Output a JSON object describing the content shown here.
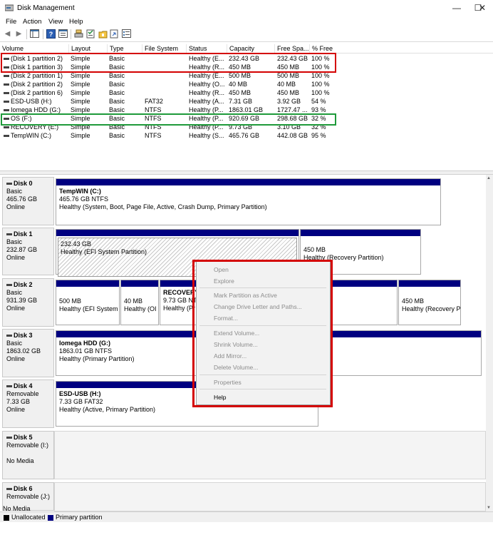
{
  "window": {
    "title": "Disk Management",
    "controls": [
      "—",
      "☐",
      "✕"
    ]
  },
  "menu": [
    "File",
    "Action",
    "View",
    "Help"
  ],
  "colors": {
    "primary": "#000080",
    "unallocated": "#000000",
    "highlight_red": "#d40000",
    "highlight_green": "#1e9a3a"
  },
  "table": {
    "headers": [
      "Volume",
      "Layout",
      "Type",
      "File System",
      "Status",
      "Capacity",
      "Free Spa...",
      "% Free"
    ],
    "rows": [
      [
        "(Disk 1 partition 2)",
        "Simple",
        "Basic",
        "",
        "Healthy (E...",
        "232.43 GB",
        "232.43 GB",
        "100 %"
      ],
      [
        "(Disk 1 partition 3)",
        "Simple",
        "Basic",
        "",
        "Healthy (R...",
        "450 MB",
        "450 MB",
        "100 %"
      ],
      [
        "(Disk 2 partition 1)",
        "Simple",
        "Basic",
        "",
        "Healthy (E...",
        "500 MB",
        "500 MB",
        "100 %"
      ],
      [
        "(Disk 2 partition 2)",
        "Simple",
        "Basic",
        "",
        "Healthy (O...",
        "40 MB",
        "40 MB",
        "100 %"
      ],
      [
        "(Disk 2 partition 6)",
        "Simple",
        "Basic",
        "",
        "Healthy (R...",
        "450 MB",
        "450 MB",
        "100 %"
      ],
      [
        "ESD-USB (H:)",
        "Simple",
        "Basic",
        "FAT32",
        "Healthy (A...",
        "7.31 GB",
        "3.92 GB",
        "54 %"
      ],
      [
        "Iomega HDD (G:)",
        "Simple",
        "Basic",
        "NTFS",
        "Healthy (P...",
        "1863.01 GB",
        "1727.47 ...",
        "93 %"
      ],
      [
        "OS (F:)",
        "Simple",
        "Basic",
        "NTFS",
        "Healthy (P...",
        "920.69 GB",
        "298.68 GB",
        "32 %"
      ],
      [
        "RECOVERY (E:)",
        "Simple",
        "Basic",
        "NTFS",
        "Healthy (P...",
        "9.73 GB",
        "3.10 GB",
        "32 %"
      ],
      [
        "TempWIN (C:)",
        "Simple",
        "Basic",
        "NTFS",
        "Healthy (S...",
        "465.76 GB",
        "442.08 GB",
        "95 %"
      ]
    ]
  },
  "disks": [
    {
      "name": "Disk 0",
      "kind": "Basic",
      "size": "465.76 GB",
      "state": "Online"
    },
    {
      "name": "Disk 1",
      "kind": "Basic",
      "size": "232.87 GB",
      "state": "Online"
    },
    {
      "name": "Disk 2",
      "kind": "Basic",
      "size": "931.39 GB",
      "state": "Online"
    },
    {
      "name": "Disk 3",
      "kind": "Basic",
      "size": "1863.02 GB",
      "state": "Online"
    },
    {
      "name": "Disk 4",
      "kind": "Removable",
      "size": "7.33 GB",
      "state": "Online"
    },
    {
      "name": "Disk 5",
      "kind": "Removable (I:)",
      "size": "",
      "state": "No Media"
    },
    {
      "name": "Disk 6",
      "kind": "Removable (J:)",
      "size": "",
      "state": "No Media"
    }
  ],
  "partitions": {
    "d0p1": {
      "title": "TempWIN  (C:)",
      "size": "465.76 GB NTFS",
      "status": "Healthy (System, Boot, Page File, Active, Crash Dump, Primary Partition)"
    },
    "d1p2": {
      "size": "232.43 GB",
      "status": "Healthy (EFI System Partition)"
    },
    "d1p3": {
      "size": "450 MB",
      "status": "Healthy (Recovery Partition)"
    },
    "d2p1": {
      "size": "500 MB",
      "status": "Healthy (EFI System P"
    },
    "d2p2": {
      "size": "40 MB",
      "status": "Healthy (OI"
    },
    "d2p3": {
      "title": "RECOVERY (E",
      "size": "9.73 GB NT",
      "status": "Healthy (Pr"
    },
    "d2p6": {
      "size": "450 MB",
      "status": "Healthy (Recovery Pa"
    },
    "d3p1": {
      "title": "Iomega HDD  (G:)",
      "size": "1863.01 GB NTFS",
      "status": "Healthy (Primary Partition)"
    },
    "d4p1": {
      "title": "ESD-USB  (H:)",
      "size": "7.33 GB FAT32",
      "status": "Healthy (Active, Primary Partition)"
    }
  },
  "context_menu": {
    "open": "Open",
    "explore": "Explore",
    "mark_active": "Mark Partition as Active",
    "change_letter": "Change Drive Letter and Paths...",
    "format": "Format...",
    "extend": "Extend Volume...",
    "shrink": "Shrink Volume...",
    "add_mirror": "Add Mirror...",
    "delete": "Delete Volume...",
    "properties": "Properties",
    "help": "Help"
  },
  "legend": {
    "unallocated": "Unallocated",
    "primary": "Primary partition"
  }
}
